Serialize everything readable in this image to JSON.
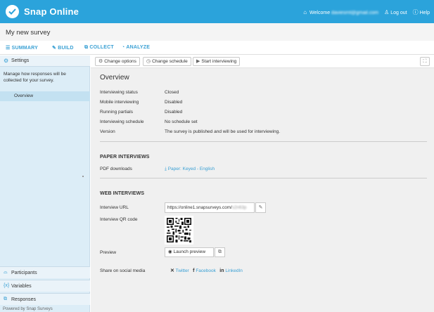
{
  "app": {
    "brand": "Snap Online"
  },
  "header": {
    "welcome_prefix": "Welcome",
    "email": "daviesmt@gmail.com",
    "logout": "Log out",
    "help": "Help"
  },
  "survey": {
    "title": "My new survey"
  },
  "nav": {
    "summary": "SUMMARY",
    "build": "BUILD",
    "collect": "COLLECT",
    "analyze": "ANALYZE"
  },
  "sidebar": {
    "settings": "Settings",
    "description": "Manage how responses will be collected for your survey.",
    "overview": "Overview",
    "participants": "Participants",
    "variables": "Variables",
    "responses": "Responses",
    "powered": "Powered by Snap Surveys"
  },
  "toolbar": {
    "change_options": "Change options",
    "change_schedule": "Change schedule",
    "start_interviewing": "Start interviewing"
  },
  "overview": {
    "title": "Overview",
    "rows": [
      {
        "label": "Interviewing status",
        "value": "Closed"
      },
      {
        "label": "Mobile interviewing",
        "value": "Disabled"
      },
      {
        "label": "Running partials",
        "value": "Disabled"
      },
      {
        "label": "Interviewing schedule",
        "value": "No schedule set"
      },
      {
        "label": "Version",
        "value": "The survey is published and will be used for interviewing."
      }
    ]
  },
  "paper": {
    "heading": "PAPER INTERVIEWS",
    "pdf_label": "PDF downloads",
    "pdf_link": "Paper: Keyed - English"
  },
  "web": {
    "heading": "WEB INTERVIEWS",
    "url_label": "Interview URL",
    "url_value": "https://online1.snapsurveys.com/",
    "url_hidden": "s2n63p",
    "qr_label": "Interview QR code",
    "preview_label": "Preview",
    "launch_preview": "Launch preview",
    "share_label": "Share on social media",
    "twitter": "Twitter",
    "facebook": "Facebook",
    "linkedin": "LinkedIn"
  },
  "colors": {
    "accent": "#2ba3db",
    "sidebar": "#dcedf7",
    "link": "#3aa0d4"
  }
}
